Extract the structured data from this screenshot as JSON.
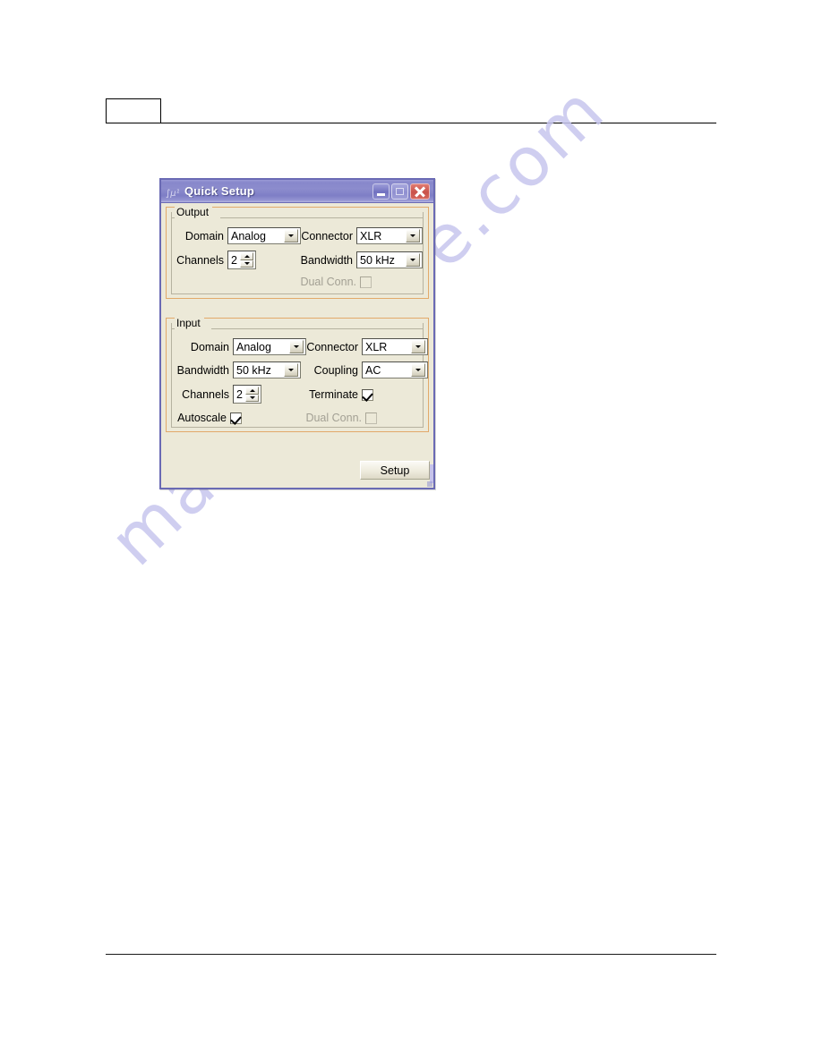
{
  "page": {
    "header_box_label": "",
    "watermark": "manualshive.com"
  },
  "dialog": {
    "title": "Quick Setup",
    "title_icon": "app-icon",
    "window_buttons": {
      "minimize": "minimize-icon",
      "maximize": "maximize-icon",
      "close": "close-icon"
    },
    "output_group": {
      "legend": "Output",
      "fields": [
        {
          "label": "Domain",
          "type": "combo",
          "value": "Analog"
        },
        {
          "label": "Connector",
          "type": "combo",
          "value": "XLR"
        },
        {
          "label": "Channels",
          "type": "spinner",
          "value": "2"
        },
        {
          "label": "Bandwidth",
          "type": "combo",
          "value": "50 kHz"
        },
        {
          "label": "Dual Conn.",
          "type": "checkbox",
          "value": "",
          "checked": false,
          "disabled": true
        }
      ]
    },
    "input_group": {
      "legend": "Input",
      "fields": [
        {
          "label": "Domain",
          "type": "combo",
          "value": "Analog"
        },
        {
          "label": "Connector",
          "type": "combo",
          "value": "XLR"
        },
        {
          "label": "Bandwidth",
          "type": "combo",
          "value": "50 kHz"
        },
        {
          "label": "Coupling",
          "type": "combo",
          "value": "AC"
        },
        {
          "label": "Channels",
          "type": "spinner",
          "value": "2"
        },
        {
          "label": "Terminate",
          "type": "checkbox",
          "value": "",
          "checked": true,
          "disabled": false
        },
        {
          "label": "Autoscale",
          "type": "checkbox",
          "value": "",
          "checked": true,
          "disabled": false
        },
        {
          "label": "Dual Conn.",
          "type": "checkbox",
          "value": "",
          "checked": false,
          "disabled": true
        }
      ]
    },
    "setup_button": "Setup"
  },
  "colors": {
    "dialog_face": "#ece9d8",
    "titlebar": "#8787cb",
    "group_border": "#e2a96a",
    "close_button": "#c9524a",
    "watermark": "#c7c6ee"
  }
}
